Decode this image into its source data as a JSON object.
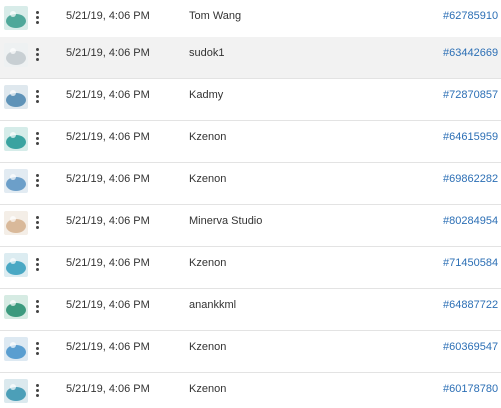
{
  "rows": [
    {
      "date": "5/21/19, 4:06 PM",
      "owner": "Tom Wang",
      "id": "#62785910",
      "thumb_color": "#4fa89a",
      "thumb_bg": "#d8ece9"
    },
    {
      "date": "5/21/19, 4:06 PM",
      "owner": "sudok1",
      "id": "#63442669",
      "thumb_color": "#c8cfd3",
      "thumb_bg": "#eef1f2"
    },
    {
      "date": "5/21/19, 4:06 PM",
      "owner": "Kadmy",
      "id": "#72870857",
      "thumb_color": "#5f93b8",
      "thumb_bg": "#dfe8ee"
    },
    {
      "date": "5/21/19, 4:06 PM",
      "owner": "Kzenon",
      "id": "#64615959",
      "thumb_color": "#3aa3a0",
      "thumb_bg": "#d5ece9"
    },
    {
      "date": "5/21/19, 4:06 PM",
      "owner": "Kzenon",
      "id": "#69862282",
      "thumb_color": "#6c9fc9",
      "thumb_bg": "#e2ebf2"
    },
    {
      "date": "5/21/19, 4:06 PM",
      "owner": "Minerva Studio",
      "id": "#80284954",
      "thumb_color": "#d9b99a",
      "thumb_bg": "#f4eee7"
    },
    {
      "date": "5/21/19, 4:06 PM",
      "owner": "Kzenon",
      "id": "#71450584",
      "thumb_color": "#4aa8c4",
      "thumb_bg": "#dcecf1"
    },
    {
      "date": "5/21/19, 4:06 PM",
      "owner": "anankkml",
      "id": "#64887722",
      "thumb_color": "#3c9a7e",
      "thumb_bg": "#d6ebe3"
    },
    {
      "date": "5/21/19, 4:06 PM",
      "owner": "Kzenon",
      "id": "#60369547",
      "thumb_color": "#5a9ed0",
      "thumb_bg": "#dde9f2"
    },
    {
      "date": "5/21/19, 4:06 PM",
      "owner": "Kzenon",
      "id": "#60178780",
      "thumb_color": "#4c9fb8",
      "thumb_bg": "#dbe9ee"
    }
  ],
  "highlighted_row": 1,
  "colors": {
    "link": "#2c6fb5",
    "text": "#333333",
    "divider": "#e3e3e3",
    "highlight": "#f2f2f2"
  }
}
